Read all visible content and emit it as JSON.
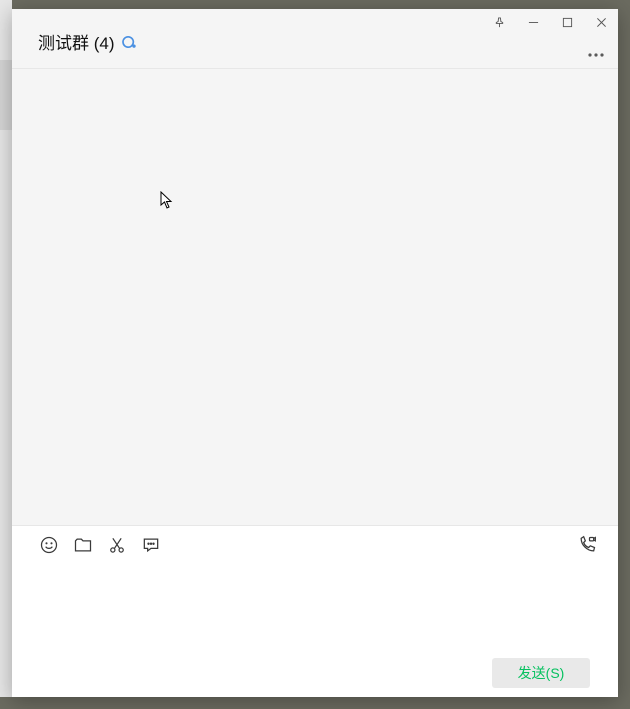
{
  "window": {
    "title": "测试群 (4)"
  },
  "toolbar": {
    "emoji_name": "emoji-icon",
    "file_name": "folder-icon",
    "screenshot_name": "scissors-icon",
    "chat_history_name": "chat-bubble-icon",
    "call_name": "phone-video-icon"
  },
  "compose": {
    "value": "",
    "placeholder": ""
  },
  "send": {
    "label": "发送(S)"
  },
  "controls": {
    "pin": "pin-icon",
    "min": "minimize-icon",
    "max": "maximize-icon",
    "close": "close-icon",
    "more": "more-icon"
  }
}
